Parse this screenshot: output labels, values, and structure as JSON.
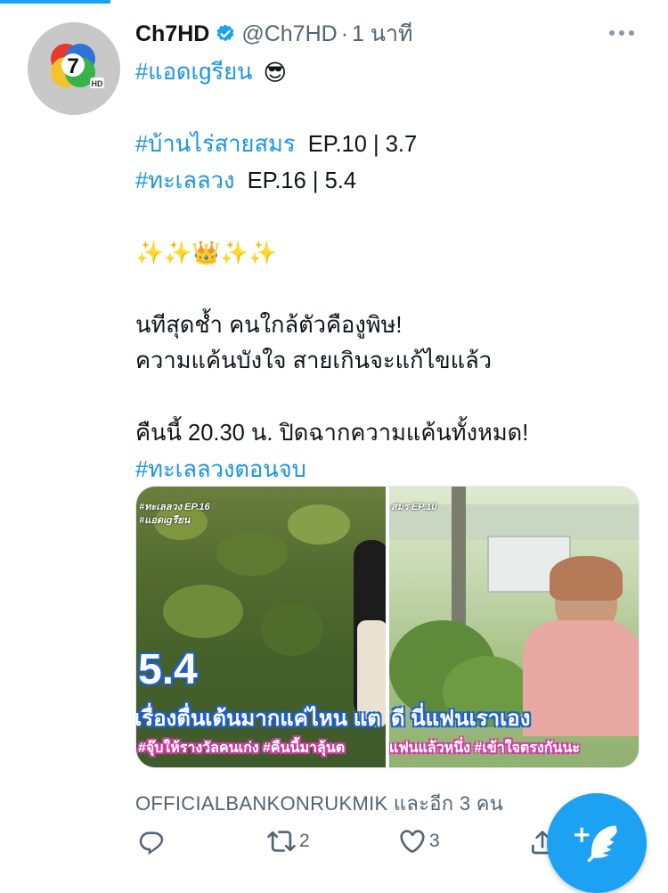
{
  "status": {
    "progress": 0.165
  },
  "tweet": {
    "name": "Ch7HD",
    "handle": "@Ch7HD",
    "separator": "·",
    "time": "1 นาที",
    "lines": [
      {
        "text": "#แอดเgรียน",
        "type": "tag",
        "emoji": "😎"
      },
      {
        "text": "",
        "type": "blank"
      },
      {
        "text": "#บ้านไร่สายสมร",
        "type": "tag",
        "suffix": "  EP.10 | 3.7"
      },
      {
        "text": "#ทะเลลวง",
        "type": "tag",
        "suffix": "  EP.16 | 5.4"
      },
      {
        "text": "",
        "type": "blank"
      },
      {
        "text": "✨✨👑✨✨",
        "type": "emoji-line"
      },
      {
        "text": "",
        "type": "blank"
      },
      {
        "text": "นทีสุดช้ำ คนใกล้ตัวคืองูพิษ!",
        "type": "plain"
      },
      {
        "text": "ความแค้นบังใจ สายเกินจะแก้ไขแล้ว",
        "type": "plain"
      },
      {
        "text": "",
        "type": "blank"
      },
      {
        "text": "คืนนี้ 20.30 น. ปิดฉากความแค้นทั้งหมด!",
        "type": "plain"
      },
      {
        "text": "#ทะเลลวงตอนจบ",
        "type": "tag"
      }
    ]
  },
  "media": {
    "left": {
      "small_tag_1": "#ทะเลลวง EP.16",
      "small_tag_2": "#แอดเgรียน",
      "big_number": "5.4",
      "caption": "เรื่องตื่นเต้นมากแค่ไหน แต",
      "hashtags": "#จุ๊บให้รางวัลคนเก่ง #คืนนี้มาลุ้นต"
    },
    "right": {
      "small_tag": "สมร EP.10",
      "caption": "ดี นี่แฟนเราเอง",
      "hashtags": "แฟนแล้วหนึ่ง #เข้าใจตรงกันนะ"
    }
  },
  "social_context": "OFFICIALBANKONRUKMIK และอีก 3 คน",
  "actions": {
    "reply_count": "",
    "retweet_count": "2",
    "like_count": "3"
  },
  "colors": {
    "accent": "#1da1f2",
    "hashtag": "#1b95e0",
    "muted": "#536471"
  },
  "icons": [
    "verified-icon",
    "more-icon",
    "reply-icon",
    "retweet-icon",
    "like-icon",
    "share-icon",
    "compose-icon"
  ]
}
